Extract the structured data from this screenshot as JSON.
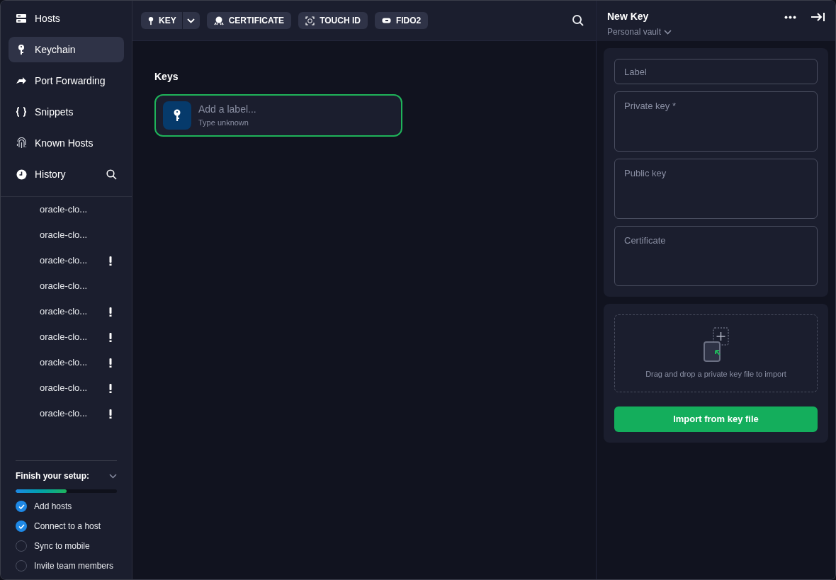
{
  "sidebar": {
    "nav": [
      {
        "label": "Hosts",
        "selected": false
      },
      {
        "label": "Keychain",
        "selected": true
      },
      {
        "label": "Port Forwarding",
        "selected": false
      },
      {
        "label": "Snippets",
        "selected": false
      },
      {
        "label": "Known Hosts",
        "selected": false
      },
      {
        "label": "History",
        "selected": false
      }
    ],
    "history": [
      {
        "label": "oracle-clo...",
        "warning": false
      },
      {
        "label": "oracle-clo...",
        "warning": false
      },
      {
        "label": "oracle-clo...",
        "warning": true
      },
      {
        "label": "oracle-clo...",
        "warning": false
      },
      {
        "label": "oracle-clo...",
        "warning": true
      },
      {
        "label": "oracle-clo...",
        "warning": true
      },
      {
        "label": "oracle-clo...",
        "warning": true
      },
      {
        "label": "oracle-clo...",
        "warning": true
      },
      {
        "label": "oracle-clo...",
        "warning": true
      }
    ],
    "setup": {
      "title": "Finish your setup:",
      "level": 0.5,
      "steps": [
        {
          "label": "Add hosts",
          "checked": true
        },
        {
          "label": "Connect to a host",
          "checked": true
        },
        {
          "label": "Sync to mobile",
          "checked": false
        },
        {
          "label": "Invite team members",
          "checked": false
        }
      ]
    }
  },
  "toolbar": {
    "buttons": [
      {
        "label": "KEY",
        "kind": "split"
      },
      {
        "label": "CERTIFICATE",
        "kind": "certificate"
      },
      {
        "label": "TOUCH ID",
        "kind": "touch"
      },
      {
        "label": "FIDO2",
        "kind": "fido"
      }
    ]
  },
  "keys": {
    "title": "Keys",
    "items": [
      {
        "label": "Add a label...",
        "type": "Type unknown",
        "selected": true
      }
    ]
  },
  "panel": {
    "title": "New Key",
    "vault": "Personal vault",
    "fields": [
      {
        "placeholder": "Label",
        "kind": "line"
      },
      {
        "placeholder": "Private key *",
        "kind": "area"
      },
      {
        "placeholder": "Public key",
        "kind": "area"
      },
      {
        "placeholder": "Certificate",
        "kind": "area"
      }
    ],
    "drop_hint": "Drag and drop a private key file to import",
    "import_button": "Import from key file"
  }
}
